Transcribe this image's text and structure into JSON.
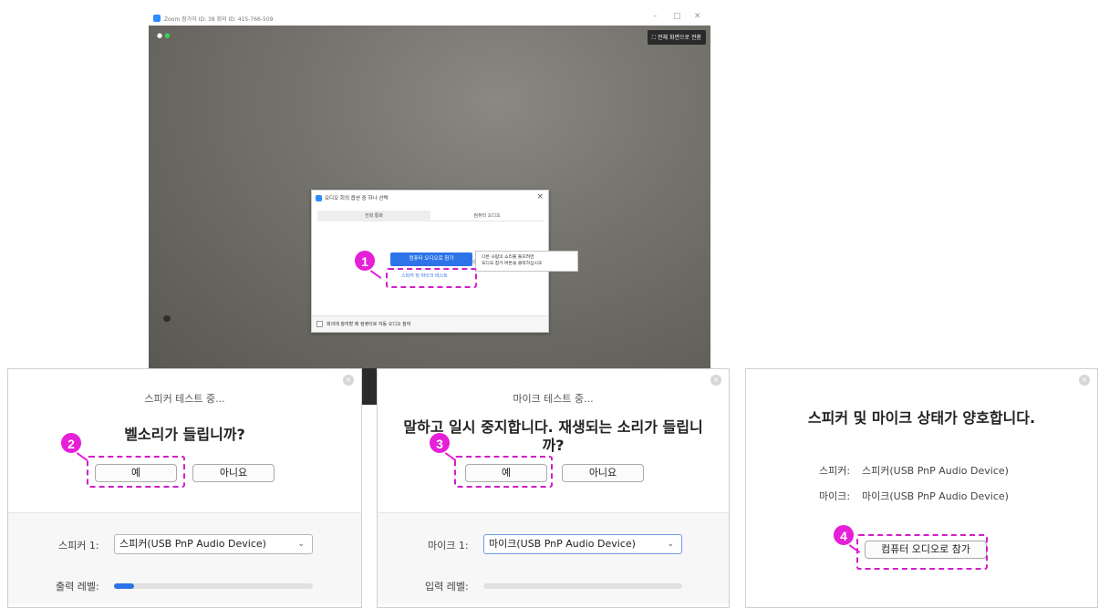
{
  "zoom": {
    "title": "Zoom 참가자 ID: 38    회의 ID: 415-766-509",
    "fullscreen_label": "전체 화면으로 전환",
    "audio_dialog": {
      "title": "오디오 회의 옵션 중 하나 선택",
      "tabs": [
        "전화 통화",
        "컴퓨터 오디오"
      ],
      "join_button": "컴퓨터 오디오로 참가",
      "test_link": "스피커 및 마이크 테스트",
      "auto_join_label": "회의에 참여할 때 컴퓨터로 자동 오디오 참여",
      "tooltip_lines": [
        "다른 사람의 소리를 들으려면",
        "오디오 참가 버튼을 클릭하십시오"
      ]
    }
  },
  "steps": [
    "1",
    "2",
    "3",
    "4"
  ],
  "speaker_panel": {
    "title": "스피커 테스트 중...",
    "question": "벨소리가 들립니까?",
    "yes": "예",
    "no": "아니요",
    "device_label": "스피커 1:",
    "device_value": "스피커(USB PnP Audio Device)",
    "level_label": "출력 레벨:",
    "level_value": 0.1
  },
  "mic_panel": {
    "title": "마이크 테스트 중...",
    "question_line1": "말하고 일시 중지합니다. 재생되는 소리가 들립니",
    "question_line2": "까?",
    "yes": "예",
    "no": "아니요",
    "device_label": "마이크 1:",
    "device_value": "마이크(USB PnP Audio Device)",
    "level_label": "입력 레벨:",
    "level_value": 0
  },
  "result_panel": {
    "title": "스피커 및 마이크 상태가 양호합니다.",
    "speaker_label": "스피커:",
    "speaker_value": "스피커(USB PnP Audio Device)",
    "mic_label": "마이크:",
    "mic_value": "마이크(USB PnP Audio Device)",
    "join_button": "컴퓨터 오디오로 참가"
  },
  "colors": {
    "accent": "#2d74e8",
    "highlight": "#e61fd8"
  }
}
